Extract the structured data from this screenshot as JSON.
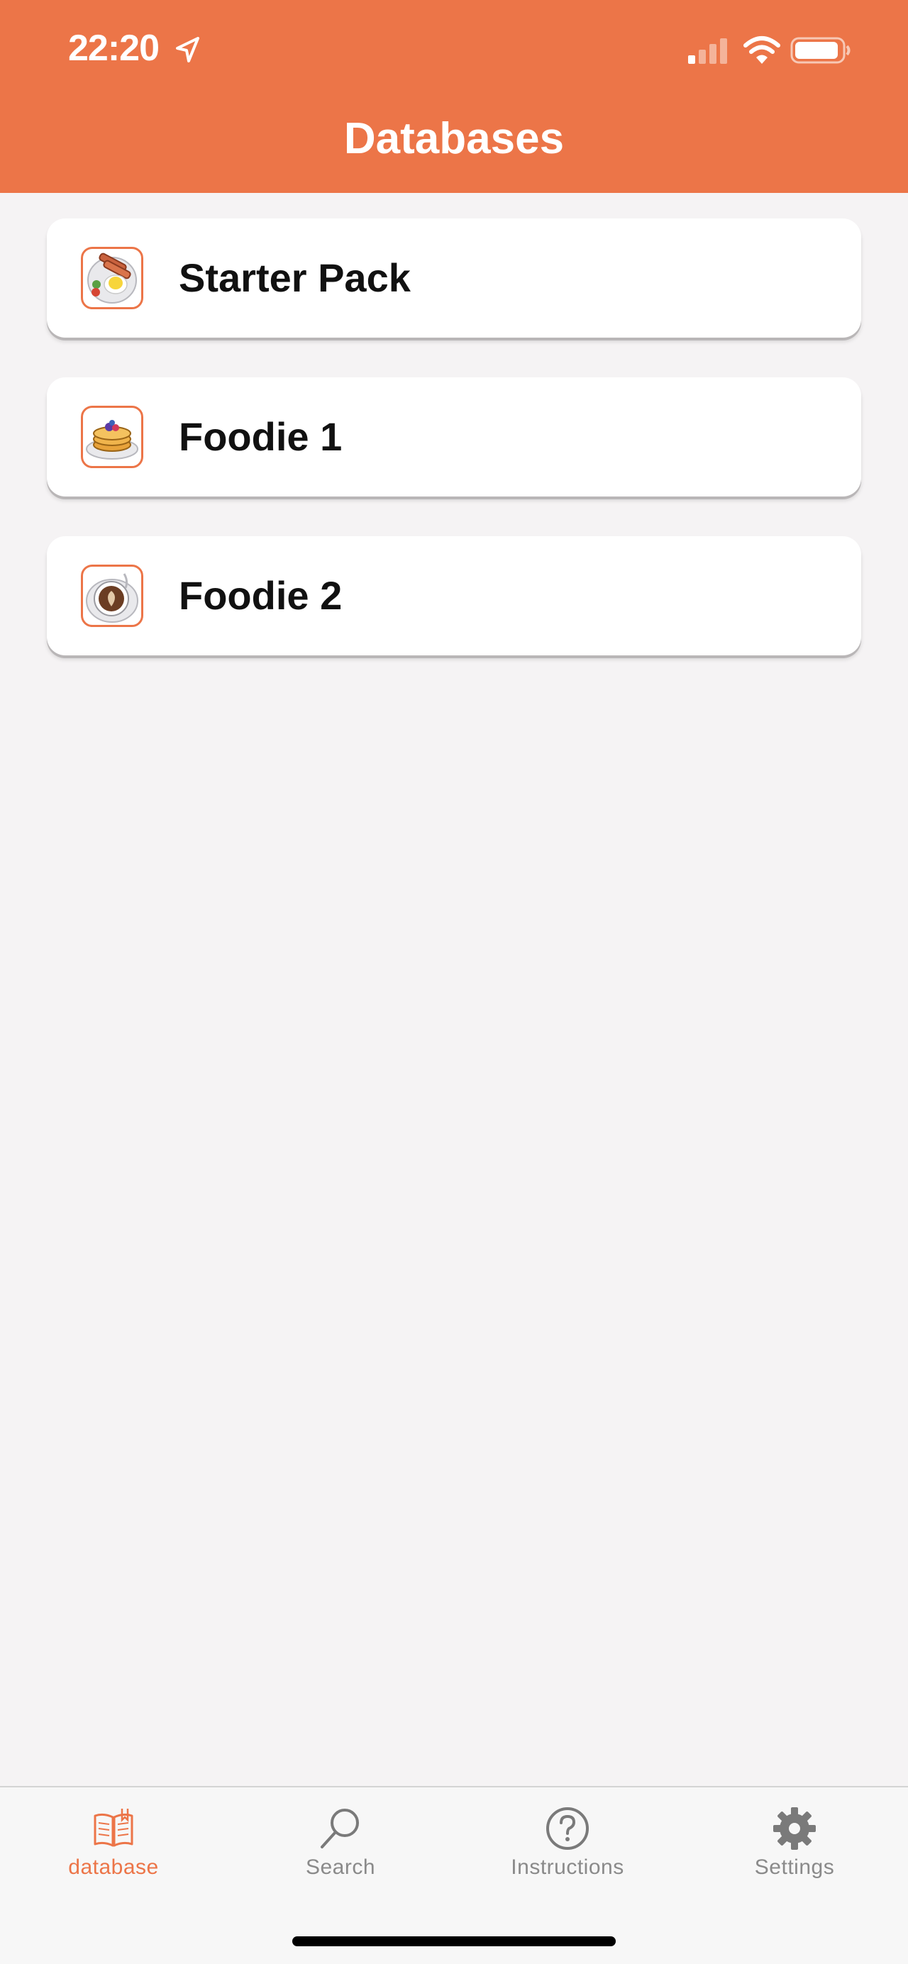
{
  "status_bar": {
    "time": "22:20",
    "icons": [
      "location-arrow-icon",
      "cellular-signal-icon",
      "wifi-icon",
      "battery-icon"
    ]
  },
  "header": {
    "title": "Databases",
    "background_color": "#ec7548"
  },
  "databases": [
    {
      "label": "Starter Pack",
      "icon": "breakfast-plate-icon"
    },
    {
      "label": "Foodie 1",
      "icon": "pancakes-icon"
    },
    {
      "label": "Foodie 2",
      "icon": "coffee-cup-icon"
    }
  ],
  "tabbar": {
    "active_color": "#ec7548",
    "inactive_color": "#8a8a8a",
    "tabs": [
      {
        "label": "database",
        "icon": "book-icon",
        "active": true
      },
      {
        "label": "Search",
        "icon": "search-icon",
        "active": false
      },
      {
        "label": "Instructions",
        "icon": "question-circle-icon",
        "active": false
      },
      {
        "label": "Settings",
        "icon": "gear-icon",
        "active": false
      }
    ]
  }
}
